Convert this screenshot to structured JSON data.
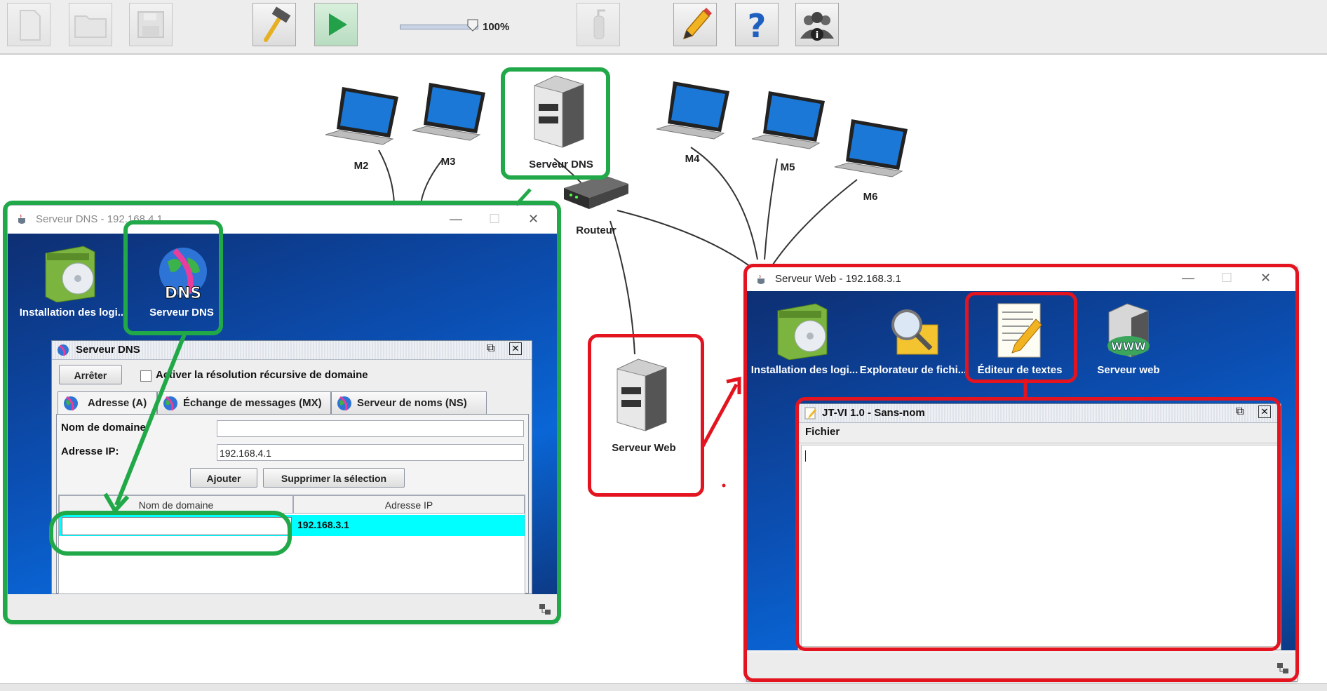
{
  "toolbar": {
    "buttons": [
      {
        "name": "new-file-button",
        "icon": "new-file-icon",
        "enabled": false
      },
      {
        "name": "open-folder-button",
        "icon": "folder-icon",
        "enabled": false
      },
      {
        "name": "save-button",
        "icon": "floppy-disk-icon",
        "enabled": false
      },
      {
        "name": "build-mode-button",
        "icon": "hammer-icon",
        "enabled": true
      },
      {
        "name": "simulation-mode-button",
        "icon": "play-icon",
        "enabled": true
      },
      {
        "name": "clean-button",
        "icon": "extinguisher-icon",
        "enabled": false
      },
      {
        "name": "edit-button",
        "icon": "pencil-icon",
        "enabled": true
      },
      {
        "name": "help-button",
        "icon": "question-mark-icon",
        "enabled": true
      },
      {
        "name": "about-button",
        "icon": "users-info-icon",
        "enabled": true
      }
    ],
    "zoom_label": "100%",
    "zoom_level_percent": 100
  },
  "network": {
    "nodes": {
      "m2": "M2",
      "m3": "M3",
      "m4": "M4",
      "m5": "M5",
      "m6": "M6",
      "dns_server": "Serveur DNS",
      "router": "Routeur",
      "web_server": "Serveur Web"
    }
  },
  "dns_window": {
    "title": "Serveur DNS - 192.168.4.1",
    "desktop_icons": [
      {
        "label": "Installation des logi...",
        "icon": "software-install-icon"
      },
      {
        "label": "Serveur DNS",
        "icon": "dns-globe-icon"
      }
    ],
    "app": {
      "title": "Serveur DNS",
      "stop_button": "Arrêter",
      "recursive_checkbox_label": "Activer la résolution récursive de domaine",
      "recursive_checked": false,
      "tabs": [
        "Adresse (A)",
        "Échange de messages (MX)",
        "Serveur de noms (NS)"
      ],
      "active_tab": "Adresse (A)",
      "domain_label": "Nom de domaine",
      "domain_value": "",
      "ip_label": "Adresse IP:",
      "ip_value": "192.168.4.1",
      "add_button": "Ajouter",
      "delete_button": "Supprimer la sélection",
      "table": {
        "columns": [
          "Nom de domaine",
          "Adresse IP"
        ],
        "rows": [
          {
            "domain": "",
            "ip": "192.168.3.1",
            "selected": true
          }
        ]
      }
    }
  },
  "web_window": {
    "title": "Serveur Web - 192.168.3.1",
    "desktop_icons": [
      {
        "label": "Installation des logi...",
        "icon": "software-install-icon"
      },
      {
        "label": "Explorateur de fichi...",
        "icon": "file-explorer-icon"
      },
      {
        "label": "Éditeur de textes",
        "icon": "text-editor-icon"
      },
      {
        "label": "Serveur web",
        "icon": "web-server-icon"
      }
    ],
    "editor": {
      "title": "JT-VI 1.0 - Sans-nom",
      "menu_file": "Fichier",
      "content": ""
    }
  },
  "colors": {
    "annotation_green": "#21a848",
    "annotation_red": "#e3141f",
    "desktop_blue": "#0b4fb3",
    "selected_row": "#00ffff"
  }
}
